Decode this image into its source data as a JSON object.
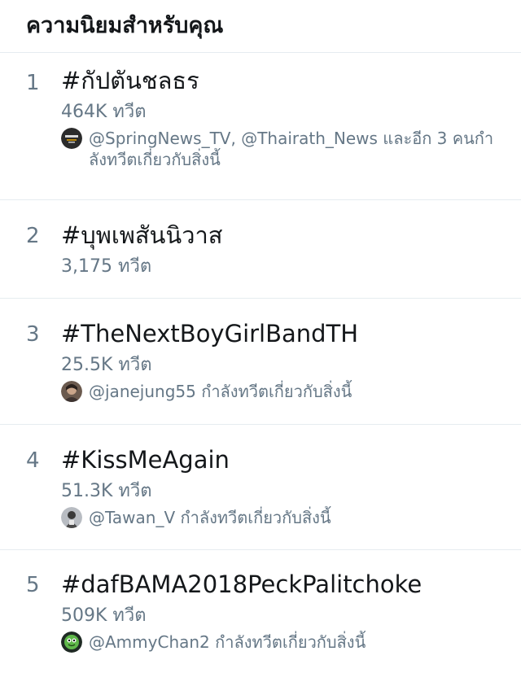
{
  "header": {
    "title": "ความนิยมสำหรับคุณ"
  },
  "trends": [
    {
      "rank": "1",
      "hashtag": "#กัปตันชลธร",
      "count": "464K ทวีต",
      "context": "@SpringNews_TV, @Thairath_News และอีก 3 คนกำลังทวีตเกี่ยวกับสิ่งนี้",
      "avatar_icon": "springnews-logo-avatar"
    },
    {
      "rank": "2",
      "hashtag": "#บุพเพสันนิวาส",
      "count": "3,175 ทวีต"
    },
    {
      "rank": "3",
      "hashtag": "#TheNextBoyGirlBandTH",
      "count": "25.5K ทวีต",
      "context": "@janejung55 กำลังทวีตเกี่ยวกับสิ่งนี้",
      "avatar_icon": "user-photo-avatar"
    },
    {
      "rank": "4",
      "hashtag": "#KissMeAgain",
      "count": "51.3K ทวีต",
      "context": "@Tawan_V กำลังทวีตเกี่ยวกับสิ่งนี้",
      "avatar_icon": "user-photo-avatar"
    },
    {
      "rank": "5",
      "hashtag": "#dafBAMA2018PeckPalitchoke",
      "count": "509K ทวีต",
      "context": "@AmmyChan2 กำลังทวีตเกี่ยวกับสิ่งนี้",
      "avatar_icon": "character-avatar"
    }
  ]
}
